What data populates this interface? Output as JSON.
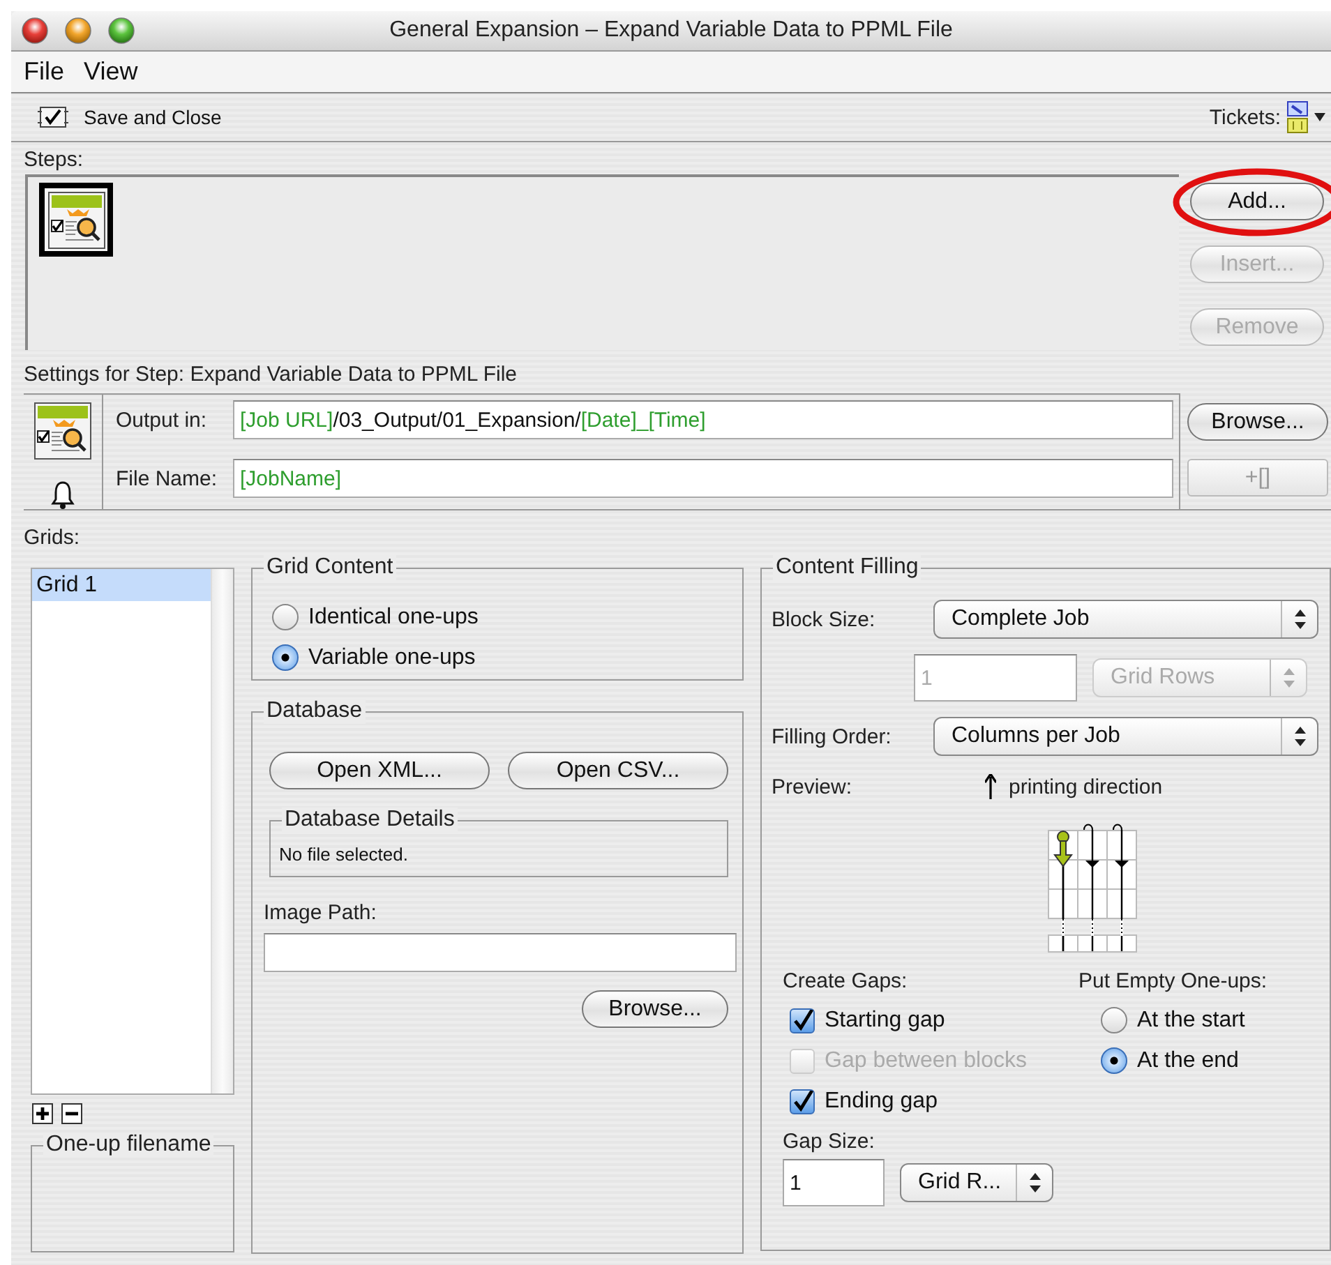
{
  "window": {
    "title": "General Expansion – Expand Variable Data to PPML File"
  },
  "menu": [
    "File",
    "View"
  ],
  "toolbar": {
    "save": "Save and Close",
    "tickets": "Tickets:"
  },
  "steps": {
    "label": "Steps:",
    "items": [
      {
        "selected": true
      }
    ],
    "buttons": [
      {
        "label": "Add...",
        "disabled": false,
        "highlighted": true
      },
      {
        "label": "Insert...",
        "disabled": true,
        "highlighted": false
      },
      {
        "label": "Remove",
        "disabled": true,
        "highlighted": false
      }
    ]
  },
  "settings": {
    "title": "Settings for Step: Expand Variable Data to PPML File",
    "fields": [
      {
        "label": "Output in:",
        "segments": [
          {
            "text": "[Job URL]",
            "kind": "variable"
          },
          {
            "text": "/03_Output/01_Expansion/",
            "kind": "literal"
          },
          {
            "text": "[Date]_[Time]",
            "kind": "variable"
          }
        ]
      },
      {
        "label": "File Name:",
        "segments": [
          {
            "text": "[JobName]",
            "kind": "variable"
          }
        ]
      }
    ],
    "buttons": [
      {
        "label": "Browse...",
        "disabled": false
      },
      {
        "label": "+[]",
        "disabled": true
      }
    ]
  },
  "grids": {
    "label": "Grids:",
    "items": [
      {
        "label": "Grid 1",
        "selected": true
      }
    ],
    "filename_group": "One-up filename"
  },
  "grid_content": {
    "title": "Grid Content",
    "options": [
      {
        "label": "Identical one-ups",
        "selected": false
      },
      {
        "label": "Variable one-ups",
        "selected": true
      }
    ]
  },
  "database": {
    "title": "Database",
    "buttons": [
      "Open XML...",
      "Open CSV..."
    ],
    "details_title": "Database Details",
    "details": "No file selected.",
    "image_path_label": "Image Path:",
    "browse": "Browse..."
  },
  "content_filling": {
    "title": "Content Filling",
    "block_size": {
      "label": "Block Size:",
      "value": "Complete Job"
    },
    "block_count": {
      "value": "1",
      "disabled": true
    },
    "block_unit": {
      "value": "Grid Rows",
      "disabled": true
    },
    "filling_order": {
      "label": "Filling Order:",
      "value": "Columns per Job"
    },
    "preview": {
      "label": "Preview:",
      "direction": "printing direction"
    },
    "gaps": {
      "label": "Create Gaps:",
      "options": [
        {
          "label": "Starting gap",
          "checked": true,
          "disabled": false
        },
        {
          "label": "Gap between blocks",
          "checked": false,
          "disabled": true
        },
        {
          "label": "Ending gap",
          "checked": true,
          "disabled": false
        }
      ]
    },
    "empty": {
      "label": "Put Empty One-ups:",
      "options": [
        {
          "label": "At the start",
          "selected": false
        },
        {
          "label": "At the end",
          "selected": true
        }
      ]
    },
    "gap_size": {
      "label": "Gap Size:",
      "value": "1",
      "unit": "Grid R..."
    }
  }
}
